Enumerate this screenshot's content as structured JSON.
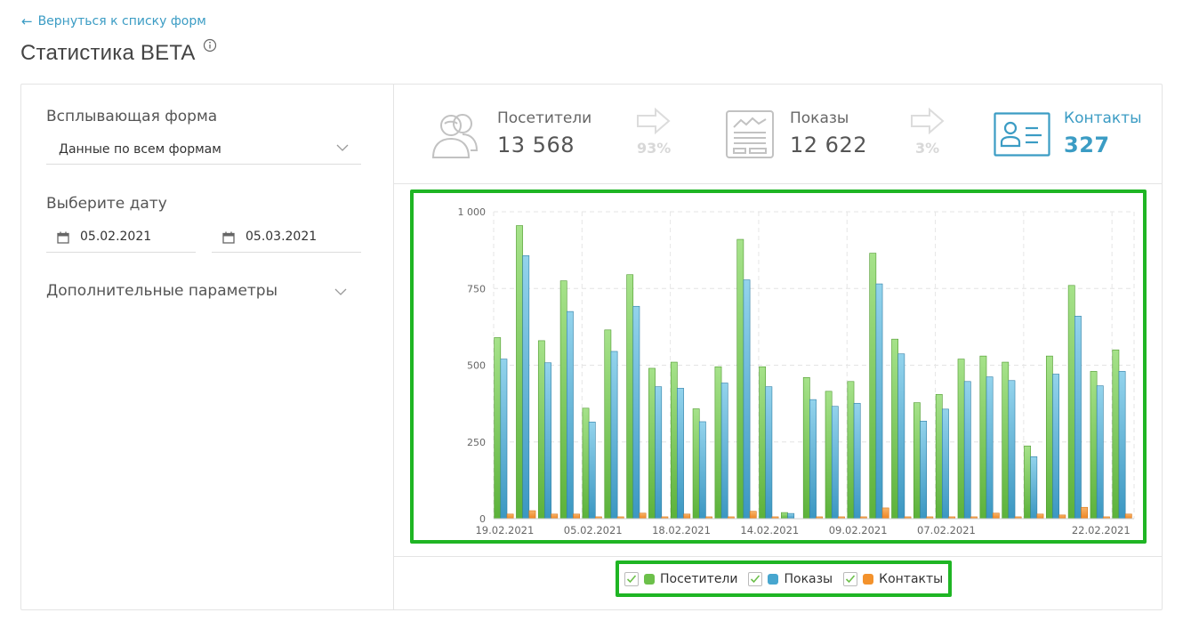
{
  "nav": {
    "back_label": "Вернуться к списку форм"
  },
  "page": {
    "title": "Статистика BETA",
    "info_icon": "info-icon"
  },
  "filters": {
    "form_label": "Всплывающая форма",
    "form_selected": "Данные по всем формам",
    "date_label": "Выберите дату",
    "date_from": "05.02.2021",
    "date_to": "05.03.2021",
    "extra_label": "Дополнительные параметры"
  },
  "stats": {
    "visitors": {
      "label": "Посетители",
      "value": "13 568",
      "icon": "visitors-icon"
    },
    "conv1": "93%",
    "impressions": {
      "label": "Показы",
      "value": "12 622",
      "icon": "impressions-icon"
    },
    "conv2": "3%",
    "contacts": {
      "label": "Контакты",
      "value": "327",
      "icon": "contact-card-icon"
    }
  },
  "colors": {
    "accent": "#3b9cc4",
    "visitors": "#6cc04a",
    "impressions": "#47a6cf",
    "contacts": "#f3922c",
    "highlight": "#1fb524"
  },
  "chart_data": {
    "type": "bar",
    "ylim": [
      0,
      1000
    ],
    "yticks": [
      "0",
      "250",
      "500",
      "750",
      "1 000"
    ],
    "categories": [
      "19.02.2021",
      "",
      "",
      "",
      "05.02.2021",
      "",
      "",
      "",
      "18.02.2021",
      "",
      "",
      "",
      "14.02.2021",
      "",
      "",
      "",
      "09.02.2021",
      "",
      "",
      "",
      "07.02.2021",
      "",
      "",
      "",
      "",
      "",
      "",
      "22.02.2021",
      ""
    ],
    "series": [
      {
        "name": "Посетители",
        "color": "#6cc04a",
        "values": [
          590,
          955,
          580,
          775,
          360,
          615,
          795,
          490,
          510,
          358,
          495,
          910,
          495,
          20,
          460,
          415,
          447,
          865,
          585,
          378,
          405,
          520,
          530,
          510,
          237,
          530,
          760,
          480,
          550
        ]
      },
      {
        "name": "Показы",
        "color": "#47a6cf",
        "values": [
          520,
          857,
          508,
          675,
          315,
          545,
          692,
          430,
          425,
          316,
          442,
          778,
          430,
          17,
          388,
          366,
          376,
          765,
          537,
          318,
          357,
          447,
          462,
          450,
          202,
          471,
          660,
          433,
          480
        ]
      },
      {
        "name": "Контакты",
        "color": "#f3922c",
        "values": [
          15,
          26,
          15,
          15,
          6,
          6,
          18,
          6,
          15,
          6,
          6,
          24,
          6,
          0,
          6,
          6,
          6,
          35,
          6,
          6,
          6,
          6,
          18,
          6,
          15,
          12,
          37,
          6,
          15
        ]
      }
    ]
  },
  "legend": [
    {
      "label": "Посетители",
      "color": "#6cc04a",
      "checked": true
    },
    {
      "label": "Показы",
      "color": "#47a6cf",
      "checked": true
    },
    {
      "label": "Контакты",
      "color": "#f3922c",
      "checked": true
    }
  ]
}
